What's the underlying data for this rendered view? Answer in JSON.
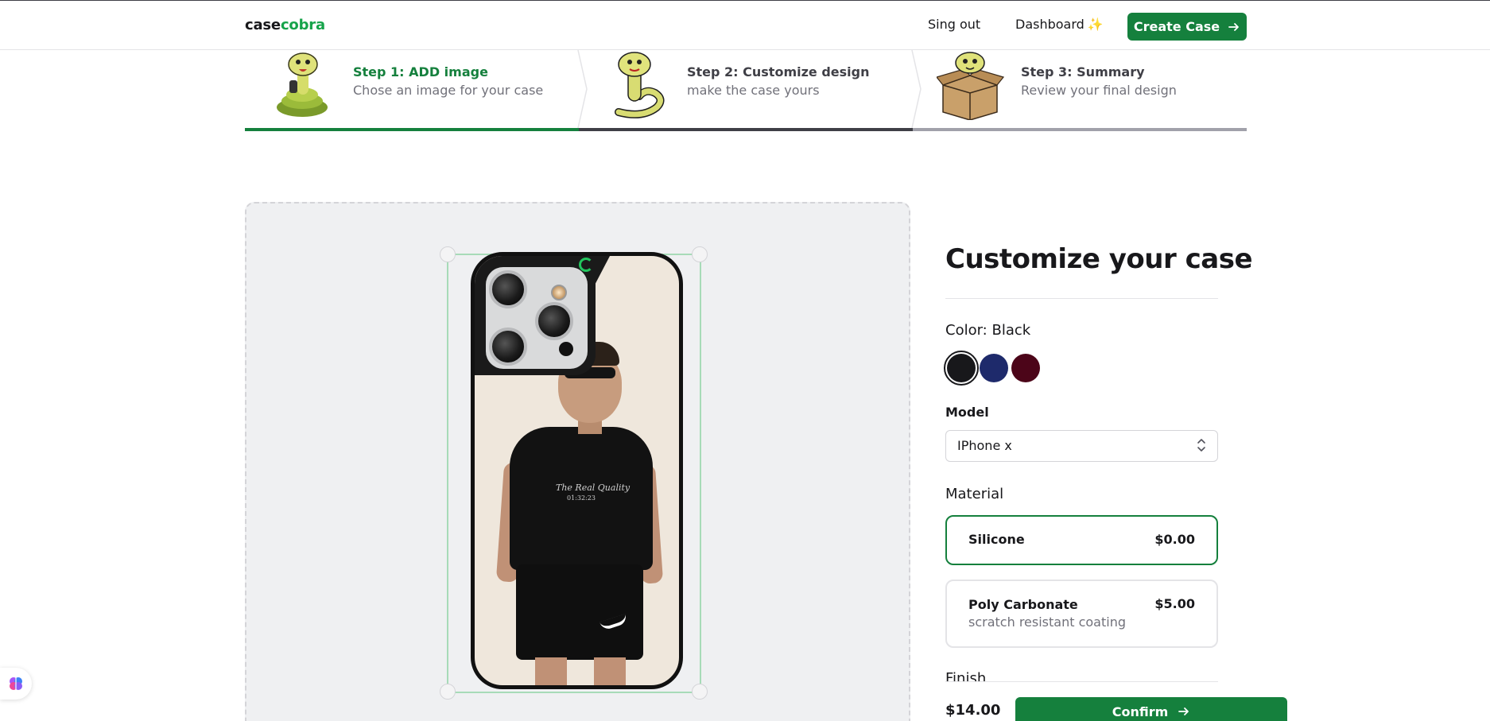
{
  "nav": {
    "logo_part1": "case",
    "logo_part2": "cobra",
    "signout": "Sing out",
    "dashboard": "Dashboard",
    "dashboard_emoji": "✨",
    "create_case": "Create Case"
  },
  "steps": [
    {
      "title": "Step 1: ADD image",
      "description": "Chose an image for your case",
      "state": "current",
      "icon": "cobra-on-snake-image"
    },
    {
      "title": "Step 2: Customize design",
      "description": "make the case yours",
      "state": "complete",
      "icon": "cobra-image"
    },
    {
      "title": "Step 3: Summary",
      "description": "Review your final design",
      "state": "upcoming",
      "icon": "cobra-in-box-image"
    }
  ],
  "design": {
    "phone_print_text": "The Real Quality",
    "phone_print_sub": "01:32:23"
  },
  "panel": {
    "title": "Customize your case",
    "color_label": "Color: Black",
    "colors": [
      {
        "name": "Black",
        "hex": "#18181b",
        "selected": true
      },
      {
        "name": "Blue",
        "hex": "#1e2a6b",
        "selected": false
      },
      {
        "name": "Rose",
        "hex": "#4c0519",
        "selected": false
      }
    ],
    "model_label": "Model",
    "model_value": "IPhone x",
    "material_label": "Material",
    "materials": [
      {
        "name": "Silicone",
        "price": "$0.00",
        "description": "",
        "selected": true
      },
      {
        "name": "Poly Carbonate",
        "price": "$5.00",
        "description": "scratch resistant coating",
        "selected": false
      }
    ],
    "finish_label": "Finish",
    "total": "$14.00",
    "confirm": "Confirm"
  },
  "colors": {
    "brand": "#15803d",
    "brand_text": "#16a34a"
  }
}
